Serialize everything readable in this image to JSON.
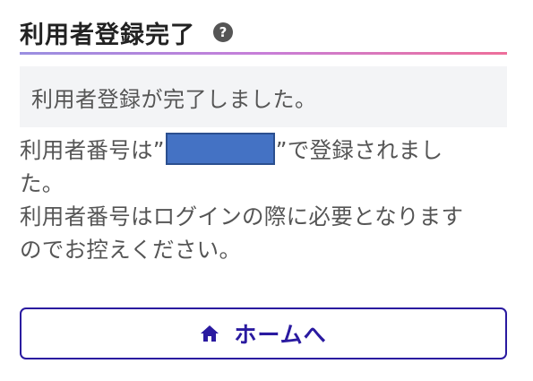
{
  "header": {
    "title": "利用者登録完了",
    "help_icon": "question-circle-icon",
    "help_glyph": "?",
    "underline_colors": [
      "#9a8fe0",
      "#c77ed8",
      "#ee6f9a"
    ]
  },
  "notice": {
    "message": "利用者登録が完了しました。"
  },
  "body": {
    "line1_prefix": "利用者番号は”",
    "user_number_redacted": true,
    "line1_suffix": "”で登録されまし",
    "line2": "た。",
    "line3": "利用者番号はログインの際に必要となりま",
    "line3_end": "す",
    "line4": "のでお控えください。"
  },
  "actions": {
    "home_label": "ホームへ",
    "home_icon": "home-icon",
    "accent_color": "#2a1aa0"
  }
}
